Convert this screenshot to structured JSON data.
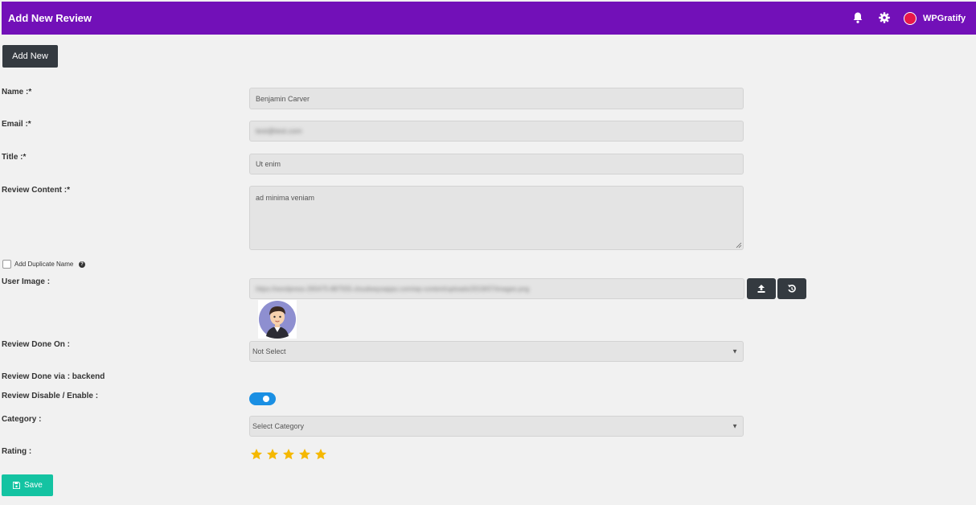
{
  "header": {
    "title": "Add New Review",
    "brand": "WPGratify",
    "bar_color": "#7210b8",
    "icons": [
      "bell-icon",
      "gear-icon",
      "brand-logo-icon"
    ]
  },
  "toolbar": {
    "add_new_label": "Add New"
  },
  "form": {
    "name": {
      "label": "Name :*",
      "value": "Benjamin Carver"
    },
    "email": {
      "label": "Email :*",
      "value": "test@test.com"
    },
    "title": {
      "label": "Title :*",
      "value": "Ut enim"
    },
    "content": {
      "label": "Review Content :*",
      "value": "ad minima veniam"
    },
    "duplicate": {
      "label": "Add Duplicate Name",
      "checked": false
    },
    "user_image": {
      "label": "User Image :",
      "value": "https://wordpress-265475-887555.cloudwaysapps.com/wp-content/uploads/2019/07/images.png"
    },
    "done_on": {
      "label": "Review Done On :",
      "value": "Not Select"
    },
    "done_via": {
      "label": "Review Done via : backend"
    },
    "enable": {
      "label": "Review Disable / Enable :",
      "enabled": true
    },
    "category": {
      "label": "Category :",
      "value": "Select Category"
    },
    "rating": {
      "label": "Rating :",
      "stars": 5,
      "max": 5,
      "star_color": "#f5b800"
    },
    "save_label": "Save",
    "save_color": "#14c3a2"
  }
}
